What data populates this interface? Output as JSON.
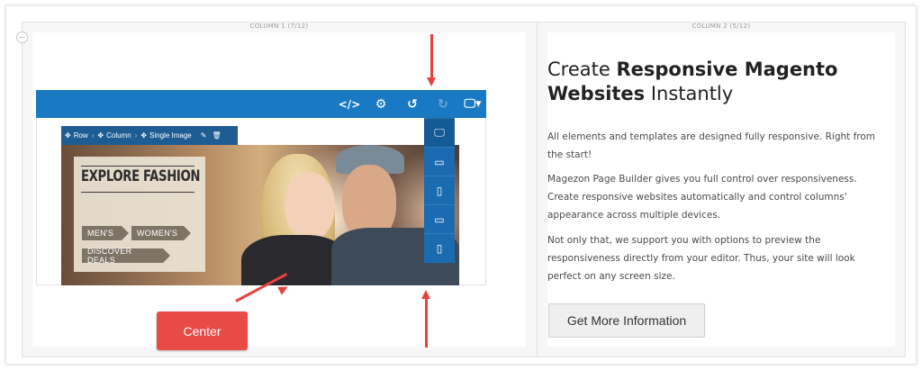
{
  "columns": {
    "col1_label": "COLUMN 1 (7/12)",
    "col2_label": "COLUMN 2 (5/12)"
  },
  "toolbar": {
    "icons": [
      "code-icon",
      "gear-icon",
      "undo-icon",
      "redo-icon",
      "desktop-device-icon",
      "fullscreen-icon"
    ],
    "brand_color": "#1979c3"
  },
  "breadcrumb": {
    "items": [
      "Row",
      "Column",
      "Single Image"
    ],
    "tools": [
      "pencil-icon",
      "trash-icon"
    ]
  },
  "image": {
    "sign_title": "EXPLORE FASHION",
    "tags": [
      "MEN'S",
      "WOMEN'S",
      "DISCOVER DEALS"
    ]
  },
  "device_menu": {
    "items": [
      "desktop-icon",
      "tablet-landscape-icon",
      "tablet-portrait-icon",
      "mobile-landscape-icon",
      "mobile-portrait-icon"
    ]
  },
  "annotation": {
    "callout_text": "Center",
    "arrow_color": "#e8423f"
  },
  "content": {
    "heading_part1": "Create ",
    "heading_bold1": "Responsive Magento",
    "heading_bold2": "Websites",
    "heading_part2": " Instantly",
    "paragraph1": "All elements and templates are designed fully responsive. Right from the start!",
    "paragraph2": "Magezon Page Builder gives you full control over responsiveness. Create responsive websites automatically and control columns' appearance across multiple devices.",
    "paragraph3": "Not only that, we support you with options to preview the responsiveness directly from your editor. Thus, your site will look perfect on any screen size.",
    "button_label": "Get More Information"
  }
}
